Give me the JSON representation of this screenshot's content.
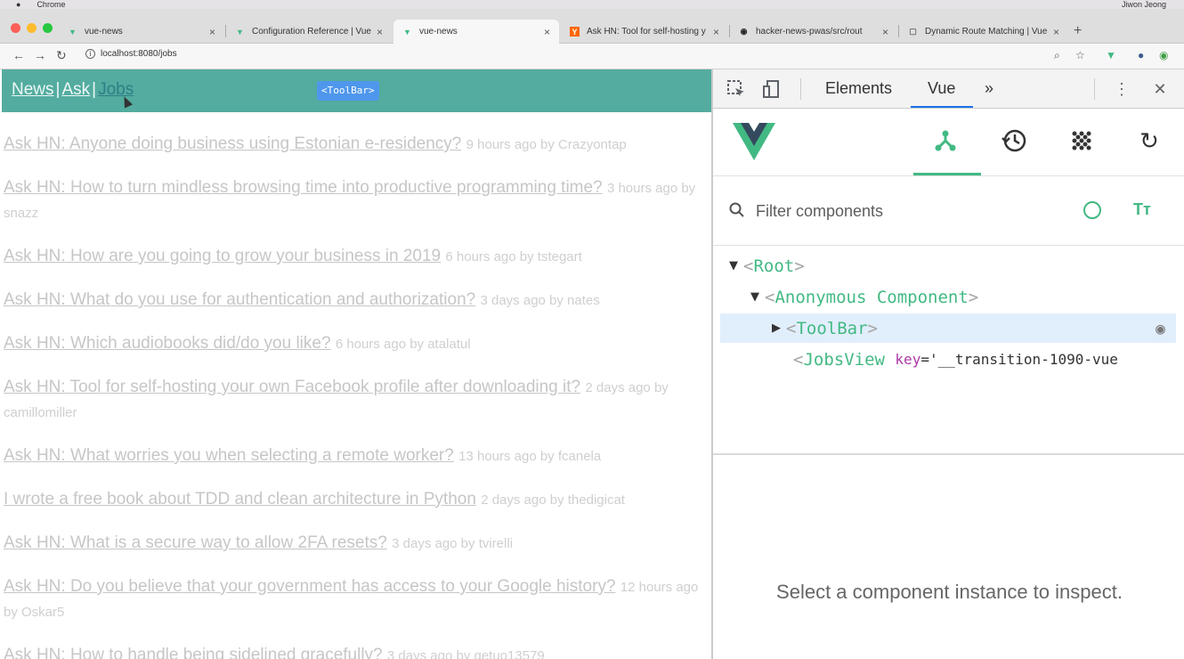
{
  "menubar": {
    "app": "Chrome",
    "right": "Jiwon Jeong"
  },
  "tabs": [
    {
      "title": "vue-news",
      "fav": "V",
      "favcolor": "#42b983"
    },
    {
      "title": "Configuration Reference | Vue",
      "fav": "V",
      "favcolor": "#42b983"
    },
    {
      "title": "vue-news",
      "fav": "V",
      "favcolor": "#42b983"
    },
    {
      "title": "Ask HN: Tool for self-hosting y",
      "fav": "Y",
      "favcolor": "#ff6600"
    },
    {
      "title": "hacker-news-pwas/src/rout",
      "fav": "◉",
      "favcolor": "#222222"
    },
    {
      "title": "Dynamic Route Matching | Vue",
      "fav": "▢",
      "favcolor": "#666666"
    }
  ],
  "address": {
    "url": "localhost:8080/jobs"
  },
  "toolbar": {
    "links": [
      "News",
      "Ask",
      "Jobs"
    ],
    "separator": "|",
    "badge": "<ToolBar>"
  },
  "jobs": [
    {
      "title": "Ask HN: Anyone doing business using Estonian e-residency?",
      "meta": "9 hours ago by Crazyontap"
    },
    {
      "title": "Ask HN: How to turn mindless browsing time into productive programming time?",
      "meta": "3 hours ago by snazz"
    },
    {
      "title": "Ask HN: How are you going to grow your business in 2019",
      "meta": "6 hours ago by tstegart"
    },
    {
      "title": "Ask HN: What do you use for authentication and authorization?",
      "meta": "3 days ago by nates"
    },
    {
      "title": "Ask HN: Which audiobooks did/do you like?",
      "meta": "6 hours ago by atalatul"
    },
    {
      "title": "Ask HN: Tool for self-hosting your own Facebook profile after downloading it?",
      "meta": "2 days ago by camillomiller"
    },
    {
      "title": "Ask HN: What worries you when selecting a remote worker?",
      "meta": "13 hours ago by fcanela"
    },
    {
      "title": "I wrote a free book about TDD and clean architecture in Python",
      "meta": "2 days ago by thedigicat"
    },
    {
      "title": "Ask HN: What is a secure way to allow 2FA resets?",
      "meta": "3 days ago by tvirelli"
    },
    {
      "title": "Ask HN: Do you believe that your government has access to your Google history?",
      "meta": "12 hours ago by Oskar5"
    },
    {
      "title": "Ask HN: How to handle being sidelined gracefully?",
      "meta": "3 days ago by qetuo13579"
    }
  ],
  "devtools": {
    "tabs": [
      "Elements",
      "Vue"
    ],
    "more": "»",
    "filter_placeholder": "Filter components",
    "tree": {
      "root": "Root",
      "anon": "Anonymous Component",
      "toolbar": "ToolBar",
      "jobsview": "JobsView",
      "jobsview_attr": "key",
      "jobsview_val": "='__transition-1090-vue"
    },
    "open_bracket": "<",
    "close_bracket": ">",
    "inspect_message": "Select a component instance to inspect."
  }
}
